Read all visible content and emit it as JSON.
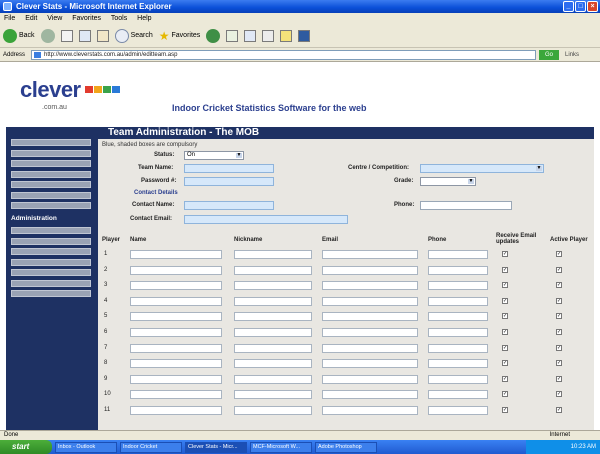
{
  "window": {
    "title": "Clever Stats - Microsoft Internet Explorer",
    "menu": [
      "File",
      "Edit",
      "View",
      "Favorites",
      "Tools",
      "Help"
    ]
  },
  "toolbar": {
    "back": "Back",
    "search": "Search",
    "favorites": "Favorites"
  },
  "address": {
    "label": "Address",
    "url": "http://www.cleverstats.com.au/admin/editteam.asp",
    "go": "Go",
    "links": "Links"
  },
  "site": {
    "logo_text": "clever",
    "logo_domain": ".com.au",
    "tagline": "Indoor Cricket Statistics Software for the web"
  },
  "sidebar": {
    "admin_title": "Administration"
  },
  "form": {
    "header": "Team Administration - The MOB",
    "required_note": "Blue, shaded boxes are compulsory",
    "status_label": "Status:",
    "status_value": "On",
    "team_name_label": "Team Name:",
    "password_label": "Password #:",
    "centre_label": "Centre / Competition:",
    "grade_label": "Grade:",
    "contact_details": "Contact Details",
    "contact_name_label": "Contact Name:",
    "phone_label": "Phone:",
    "contact_email_label": "Contact Email:"
  },
  "players_table": {
    "columns": [
      "Player",
      "Name",
      "Nickname",
      "Email",
      "Phone",
      "Receive Email updates",
      "Active Player"
    ],
    "rows": [
      "1",
      "2",
      "3",
      "4",
      "5",
      "6",
      "7",
      "8",
      "9",
      "10",
      "11"
    ]
  },
  "status": {
    "left": "Done",
    "zone": "Internet"
  },
  "taskbar": {
    "start": "start",
    "tasks": [
      "Inbox - Outlook",
      "Indoor Cricket",
      "Clever Stats - Micr...",
      "MCF-Microsoft W...",
      "Adobe Photoshop"
    ],
    "clock": "10:23 AM"
  },
  "colors": {
    "navy": "#1e3163",
    "form_bg": "#e9e7e2",
    "input_blue": "#d6e8fa"
  }
}
